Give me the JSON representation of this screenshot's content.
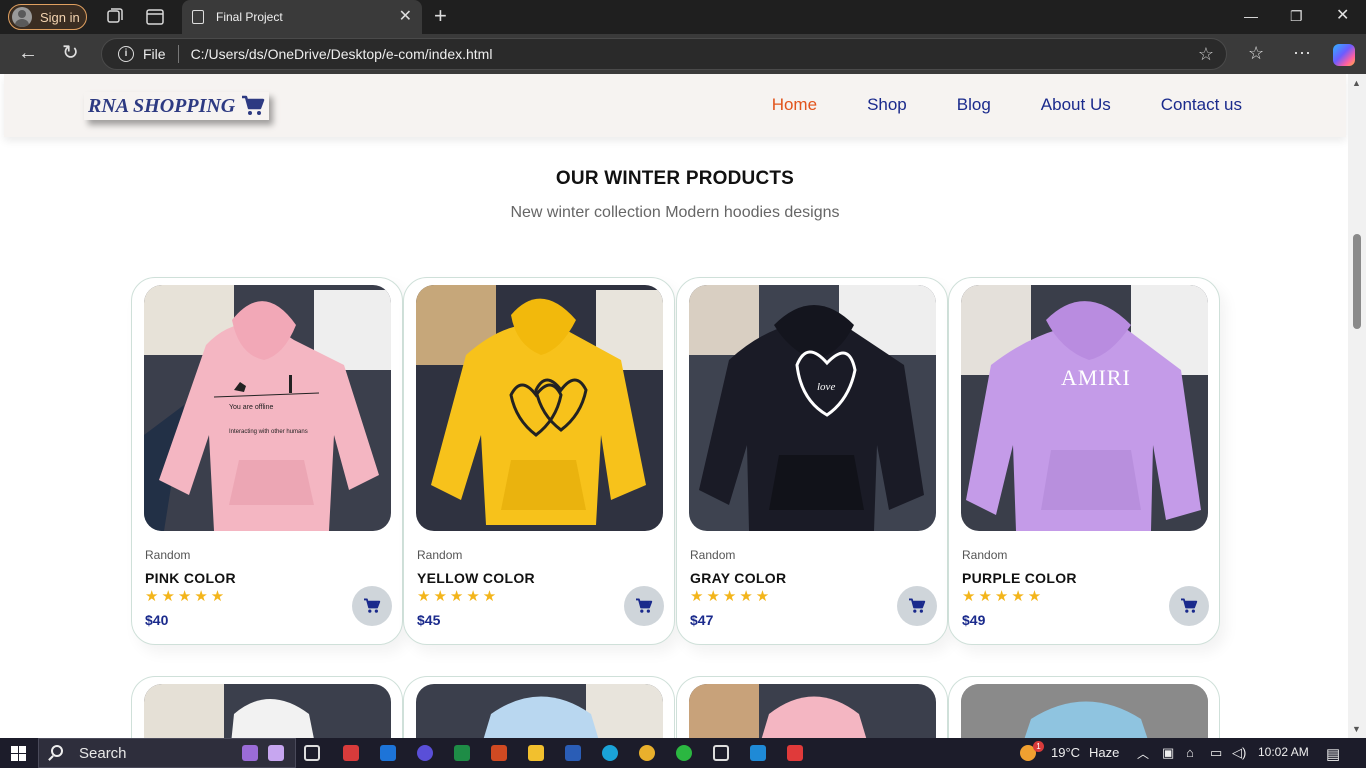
{
  "browser": {
    "signin_label": "Sign in",
    "tab_title": "Final Project",
    "address_prefix": "File",
    "url": "C:/Users/ds/OneDrive/Desktop/e-com/index.html"
  },
  "site": {
    "logo_text": "RNA SHOPPING",
    "nav": [
      {
        "label": "Home",
        "active": true
      },
      {
        "label": "Shop",
        "active": false
      },
      {
        "label": "Blog",
        "active": false
      },
      {
        "label": "About Us",
        "active": false
      },
      {
        "label": "Contact us",
        "active": false
      }
    ],
    "section_title": "OUR WINTER PRODUCTS",
    "section_subtitle": "New winter collection Modern hoodies designs",
    "products": [
      {
        "brand": "Random",
        "name": "PINK COLOR",
        "price": "$40",
        "rating": 5,
        "hoodie_color": "#f4b6c2",
        "print": "You are offline"
      },
      {
        "brand": "Random",
        "name": "YELLOW COLOR",
        "price": "$45",
        "rating": 5,
        "hoodie_color": "#f7c21b",
        "print": "hearts"
      },
      {
        "brand": "Random",
        "name": "GRAY COLOR",
        "price": "$47",
        "rating": 5,
        "hoodie_color": "#1a1b26",
        "print": "love heart"
      },
      {
        "brand": "Random",
        "name": "PURPLE COLOR",
        "price": "$49",
        "rating": 5,
        "hoodie_color": "#c49be8",
        "print": "AMIRI"
      }
    ],
    "next_row_colors": [
      "#f2f2f2",
      "#b9d7f0",
      "#f4b6c2",
      "#8fc4e0"
    ],
    "colors": {
      "nav_link": "#1a2a8c",
      "nav_active": "#e2541c",
      "star": "#f3b51b",
      "price": "#1a2a8c"
    }
  },
  "taskbar": {
    "search_label": "Search",
    "weather_temp": "19°C",
    "weather_desc": "Haze",
    "time": "10:02 AM",
    "weather_badge": "1"
  }
}
